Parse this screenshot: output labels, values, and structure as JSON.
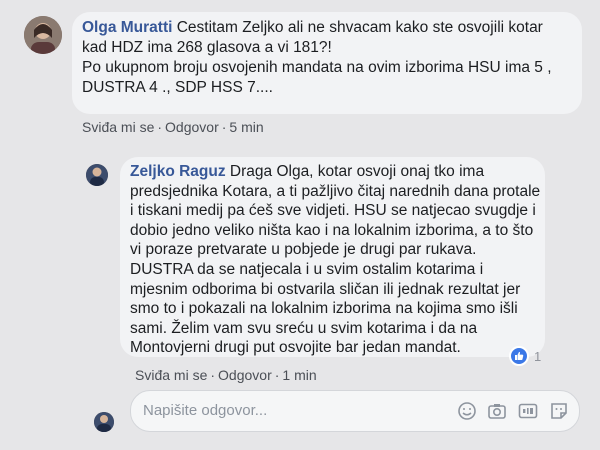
{
  "comment1": {
    "author": "Olga Muratti",
    "lines": [
      "Cestitam Zeljko ali ne shvacam kako ste osvojili kotar",
      "kad HDZ ima 268 glasova a vi 181?!",
      "Po ukupnom broju osvojenih mandata na ovim izborima HSU ima 5 ,",
      "DUSTRA 4 ., SDP HSS 7...."
    ],
    "like": "Sviđa mi se",
    "reply": "Odgovor",
    "time": "5 min"
  },
  "comment2": {
    "author": "Zeljko Raguz",
    "lines": [
      "Draga Olga, kotar osvoji onaj tko ima",
      "predsjednika Kotara, a ti pažljivo čitaj narednih dana protale",
      "i tiskani medij pa ćeš sve vidjeti. HSU se natjecao svugdje i",
      "dobio jedno veliko ništa kao i na lokalnim izborima, a to što",
      "vi poraze pretvarate u pobjede je drugi par rukava.",
      "DUSTRA da se natjecala i u svim ostalim kotarima i",
      "mjesnim odborima bi ostvarila sličan ili jednak rezultat jer",
      "smo to i pokazali na lokalnim izborima na kojima smo išli",
      "sami. Želim vam svu sreću u svim kotarima i da na",
      "Montovjerni drugi put osvojite bar jedan mandat."
    ],
    "like": "Sviđa mi se",
    "reply": "Odgovor",
    "time": "1 min",
    "reaction_count": "1"
  },
  "reply_box": {
    "placeholder": "Napišite odgovor..."
  },
  "icons": [
    "emoji-icon",
    "camera-icon",
    "gif-icon",
    "sticker-icon"
  ]
}
